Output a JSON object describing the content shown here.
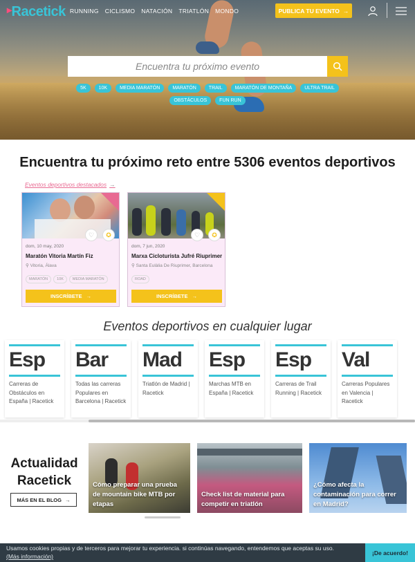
{
  "header": {
    "logo": "Racetick",
    "nav": [
      "RUNNING",
      "CICLISMO",
      "NATACIÓN",
      "TRIATLÓN",
      "MONDO"
    ],
    "publish_label": "PUBLICA TU EVENTO"
  },
  "search": {
    "placeholder": "Encuentra tu próximo evento"
  },
  "tags": [
    "5K",
    "10K",
    "MEDIA MARATÓN",
    "MARATÓN",
    "TRAIL",
    "MARATÓN DE MONTAÑA",
    "ULTRA TRAIL",
    "OBSTÁCULOS",
    "FUN RUN"
  ],
  "headline": "Encuentra tu próximo reto entre 5306 eventos deportivos",
  "featured_link": "Eventos deportivos destacados",
  "events": [
    {
      "date": "dom, 10 may, 2020",
      "title": "Maratón Vitoria Martín Fiz",
      "location": "Vitoria, Álava",
      "tags": [
        "MARATÓN",
        "10K",
        "MEDIA MARATÓN"
      ],
      "cta": "INSCRÍBETE"
    },
    {
      "date": "dom, 7 jun, 2020",
      "title": "Marxa Cicloturista Jufré Riuprimer",
      "location": "Santa Eulàlia De Riuprimer, Barcelona",
      "tags": [
        "ROAD"
      ],
      "cta": "INSCRÍBETE"
    }
  ],
  "anywhere_title": "Eventos deportivos en cualquier lugar",
  "cities": [
    {
      "abbr": "Esp",
      "desc": "Carreras de Obstáculos en España | Racetick"
    },
    {
      "abbr": "Bar",
      "desc": "Todas las carreras Populares en Barcelona | Racetick"
    },
    {
      "abbr": "Mad",
      "desc": "Triatlón de Madrid | Racetick"
    },
    {
      "abbr": "Esp",
      "desc": "Marchas MTB en España | Racetick"
    },
    {
      "abbr": "Esp",
      "desc": "Carreras de Trail Running | Racetick"
    },
    {
      "abbr": "Val",
      "desc": "Carreras Populares en Valencia | Racetick"
    }
  ],
  "news": {
    "title_line1": "Actualidad",
    "title_line2": "Racetick",
    "blog_label": "MÁS EN EL BLOG",
    "articles": [
      "Cómo preparar una prueba de mountain bike MTB por etapas",
      "Check list de material para competir en triatlón",
      "¿Cómo afecta la contaminación para correr en Madrid?"
    ]
  },
  "cookies": {
    "text": "Usamos cookies propias y de terceros para mejorar tu experiencia. si continúas navegando, entendemos que aceptas su uso.",
    "link": "(Más información)",
    "accept": "¡De acuerdo!"
  },
  "colors": {
    "accent": "#39c4d7",
    "cta": "#f4c21b",
    "pink": "#e86a92"
  }
}
